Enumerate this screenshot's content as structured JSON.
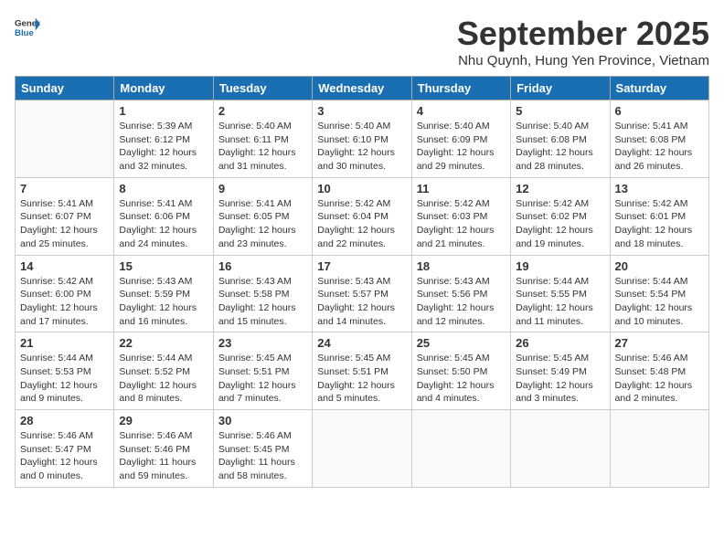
{
  "header": {
    "logo_line1": "General",
    "logo_line2": "Blue",
    "month_title": "September 2025",
    "subtitle": "Nhu Quynh, Hung Yen Province, Vietnam"
  },
  "weekdays": [
    "Sunday",
    "Monday",
    "Tuesday",
    "Wednesday",
    "Thursday",
    "Friday",
    "Saturday"
  ],
  "weeks": [
    [
      {
        "day": "",
        "info": ""
      },
      {
        "day": "1",
        "info": "Sunrise: 5:39 AM\nSunset: 6:12 PM\nDaylight: 12 hours\nand 32 minutes."
      },
      {
        "day": "2",
        "info": "Sunrise: 5:40 AM\nSunset: 6:11 PM\nDaylight: 12 hours\nand 31 minutes."
      },
      {
        "day": "3",
        "info": "Sunrise: 5:40 AM\nSunset: 6:10 PM\nDaylight: 12 hours\nand 30 minutes."
      },
      {
        "day": "4",
        "info": "Sunrise: 5:40 AM\nSunset: 6:09 PM\nDaylight: 12 hours\nand 29 minutes."
      },
      {
        "day": "5",
        "info": "Sunrise: 5:40 AM\nSunset: 6:08 PM\nDaylight: 12 hours\nand 28 minutes."
      },
      {
        "day": "6",
        "info": "Sunrise: 5:41 AM\nSunset: 6:08 PM\nDaylight: 12 hours\nand 26 minutes."
      }
    ],
    [
      {
        "day": "7",
        "info": "Sunrise: 5:41 AM\nSunset: 6:07 PM\nDaylight: 12 hours\nand 25 minutes."
      },
      {
        "day": "8",
        "info": "Sunrise: 5:41 AM\nSunset: 6:06 PM\nDaylight: 12 hours\nand 24 minutes."
      },
      {
        "day": "9",
        "info": "Sunrise: 5:41 AM\nSunset: 6:05 PM\nDaylight: 12 hours\nand 23 minutes."
      },
      {
        "day": "10",
        "info": "Sunrise: 5:42 AM\nSunset: 6:04 PM\nDaylight: 12 hours\nand 22 minutes."
      },
      {
        "day": "11",
        "info": "Sunrise: 5:42 AM\nSunset: 6:03 PM\nDaylight: 12 hours\nand 21 minutes."
      },
      {
        "day": "12",
        "info": "Sunrise: 5:42 AM\nSunset: 6:02 PM\nDaylight: 12 hours\nand 19 minutes."
      },
      {
        "day": "13",
        "info": "Sunrise: 5:42 AM\nSunset: 6:01 PM\nDaylight: 12 hours\nand 18 minutes."
      }
    ],
    [
      {
        "day": "14",
        "info": "Sunrise: 5:42 AM\nSunset: 6:00 PM\nDaylight: 12 hours\nand 17 minutes."
      },
      {
        "day": "15",
        "info": "Sunrise: 5:43 AM\nSunset: 5:59 PM\nDaylight: 12 hours\nand 16 minutes."
      },
      {
        "day": "16",
        "info": "Sunrise: 5:43 AM\nSunset: 5:58 PM\nDaylight: 12 hours\nand 15 minutes."
      },
      {
        "day": "17",
        "info": "Sunrise: 5:43 AM\nSunset: 5:57 PM\nDaylight: 12 hours\nand 14 minutes."
      },
      {
        "day": "18",
        "info": "Sunrise: 5:43 AM\nSunset: 5:56 PM\nDaylight: 12 hours\nand 12 minutes."
      },
      {
        "day": "19",
        "info": "Sunrise: 5:44 AM\nSunset: 5:55 PM\nDaylight: 12 hours\nand 11 minutes."
      },
      {
        "day": "20",
        "info": "Sunrise: 5:44 AM\nSunset: 5:54 PM\nDaylight: 12 hours\nand 10 minutes."
      }
    ],
    [
      {
        "day": "21",
        "info": "Sunrise: 5:44 AM\nSunset: 5:53 PM\nDaylight: 12 hours\nand 9 minutes."
      },
      {
        "day": "22",
        "info": "Sunrise: 5:44 AM\nSunset: 5:52 PM\nDaylight: 12 hours\nand 8 minutes."
      },
      {
        "day": "23",
        "info": "Sunrise: 5:45 AM\nSunset: 5:51 PM\nDaylight: 12 hours\nand 7 minutes."
      },
      {
        "day": "24",
        "info": "Sunrise: 5:45 AM\nSunset: 5:51 PM\nDaylight: 12 hours\nand 5 minutes."
      },
      {
        "day": "25",
        "info": "Sunrise: 5:45 AM\nSunset: 5:50 PM\nDaylight: 12 hours\nand 4 minutes."
      },
      {
        "day": "26",
        "info": "Sunrise: 5:45 AM\nSunset: 5:49 PM\nDaylight: 12 hours\nand 3 minutes."
      },
      {
        "day": "27",
        "info": "Sunrise: 5:46 AM\nSunset: 5:48 PM\nDaylight: 12 hours\nand 2 minutes."
      }
    ],
    [
      {
        "day": "28",
        "info": "Sunrise: 5:46 AM\nSunset: 5:47 PM\nDaylight: 12 hours\nand 0 minutes."
      },
      {
        "day": "29",
        "info": "Sunrise: 5:46 AM\nSunset: 5:46 PM\nDaylight: 11 hours\nand 59 minutes."
      },
      {
        "day": "30",
        "info": "Sunrise: 5:46 AM\nSunset: 5:45 PM\nDaylight: 11 hours\nand 58 minutes."
      },
      {
        "day": "",
        "info": ""
      },
      {
        "day": "",
        "info": ""
      },
      {
        "day": "",
        "info": ""
      },
      {
        "day": "",
        "info": ""
      }
    ]
  ]
}
